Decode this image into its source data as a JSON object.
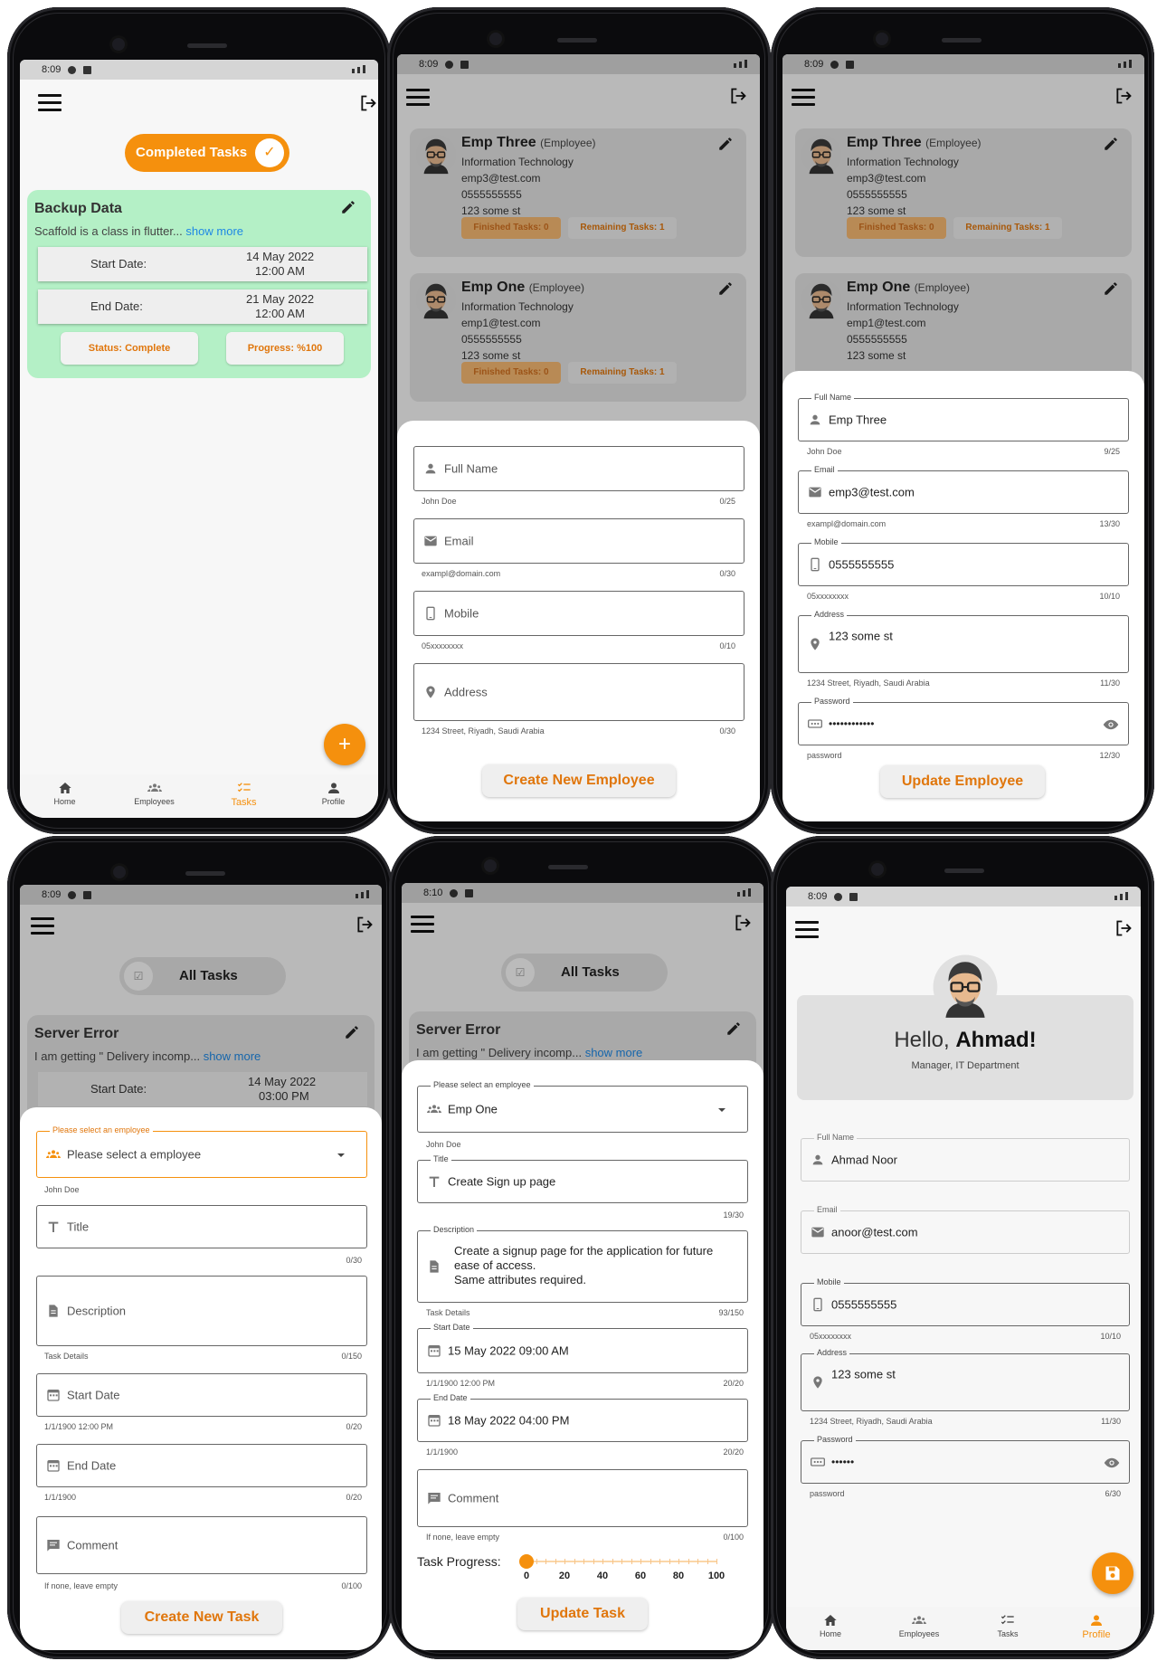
{
  "status_bar": {
    "time1": "8:09",
    "time2": "8:10"
  },
  "tasks_screen": {
    "toggle": "Completed Tasks",
    "card": {
      "title": "Backup Data",
      "desc": "Scaffold is a class in flutter...",
      "show_more": "show more",
      "start_label": "Start Date:",
      "start_date": "14 May 2022",
      "start_time": "12:00 AM",
      "end_label": "End Date:",
      "end_date": "21 May 2022",
      "end_time": "12:00 AM",
      "status": "Status: Complete",
      "progress": "Progress: %100"
    }
  },
  "nav": {
    "home": "Home",
    "employees": "Employees",
    "tasks": "Tasks",
    "profile": "Profile"
  },
  "employees": [
    {
      "name": "Emp Three",
      "role": "(Employee)",
      "dept": "Information Technology",
      "email": "emp3@test.com",
      "phone": "0555555555",
      "addr": "123 some st",
      "finished": "Finished Tasks: 0",
      "remaining": "Remaining Tasks: 1"
    },
    {
      "name": "Emp One",
      "role": "(Employee)",
      "dept": "Information Technology",
      "email": "emp1@test.com",
      "phone": "0555555555",
      "addr": "123 some st",
      "finished": "Finished Tasks: 0",
      "remaining": "Remaining Tasks: 1"
    }
  ],
  "create_employee": {
    "full_name": "Full Name",
    "full_name_helper": "John Doe",
    "full_name_count": "0/25",
    "email": "Email",
    "email_helper": "exampl@domain.com",
    "email_count": "0/30",
    "mobile": "Mobile",
    "mobile_helper": "05xxxxxxxx",
    "mobile_count": "0/10",
    "address": "Address",
    "address_helper": "1234 Street, Riyadh, Saudi Arabia",
    "address_count": "0/30",
    "button": "Create New Employee"
  },
  "update_employee": {
    "full_name_label": "Full Name",
    "full_name": "Emp Three",
    "full_name_helper": "John Doe",
    "full_name_count": "9/25",
    "email_label": "Email",
    "email": "emp3@test.com",
    "email_helper": "exampl@domain.com",
    "email_count": "13/30",
    "mobile_label": "Mobile",
    "mobile": "0555555555",
    "mobile_helper": "05xxxxxxxx",
    "mobile_count": "10/10",
    "address_label": "Address",
    "address": "123 some st",
    "address_helper": "1234 Street, Riyadh, Saudi Arabia",
    "address_count": "11/30",
    "password_label": "Password",
    "password": "••••••••••••",
    "password_helper": "password",
    "password_count": "12/30",
    "button": "Update Employee"
  },
  "all_tasks": {
    "toggle": "All Tasks",
    "card_title": "Server Error",
    "card_desc": "I am getting \" Delivery incomp...",
    "show_more": "show more",
    "start_label": "Start Date:",
    "start_date": "14 May 2022",
    "start_time": "03:00 PM"
  },
  "create_task": {
    "employee_label": "Please select an employee",
    "employee_ph": "Please select a employee",
    "employee_helper": "John Doe",
    "title": "Title",
    "title_count": "0/30",
    "description": "Description",
    "description_helper": "Task Details",
    "description_count": "0/150",
    "start": "Start Date",
    "start_helper": "1/1/1900 12:00 PM",
    "start_count": "0/20",
    "end": "End Date",
    "end_helper": "1/1/1900",
    "end_count": "0/20",
    "comment": "Comment",
    "comment_helper": "If none, leave empty",
    "comment_count": "0/100",
    "button": "Create New Task"
  },
  "update_task": {
    "employee_label": "Please select an employee",
    "employee": "Emp One",
    "employee_helper": "John Doe",
    "title_label": "Title",
    "title": "Create Sign up page",
    "title_count": "19/30",
    "description_label": "Description",
    "description_l1": "Create a signup page for the application for future",
    "description_l2": "ease of access.",
    "description_l3": "Same attributes required.",
    "description_helper": "Task Details",
    "description_count": "93/150",
    "start_label": "Start Date",
    "start": "15 May 2022 09:00 AM",
    "start_helper": "1/1/1900 12:00 PM",
    "start_count": "20/20",
    "end_label": "End Date",
    "end": "18 May 2022 04:00 PM",
    "end_helper": "1/1/1900",
    "end_count": "20/20",
    "comment": "Comment",
    "comment_helper": "If none, leave empty",
    "comment_count": "0/100",
    "progress_label": "Task Progress:",
    "progress_value": 0,
    "ticks": [
      "0",
      "20",
      "40",
      "60",
      "80",
      "100"
    ],
    "button": "Update Task"
  },
  "profile": {
    "hello": "Hello,",
    "name": "Ahmad!",
    "subtitle": "Manager, IT Department",
    "full_name_label": "Full Name",
    "full_name": "Ahmad Noor",
    "email_label": "Email",
    "email": "anoor@test.com",
    "mobile_label": "Mobile",
    "mobile": "0555555555",
    "mobile_helper": "05xxxxxxxx",
    "mobile_count": "10/10",
    "address_label": "Address",
    "address": "123 some st",
    "address_helper": "1234 Street, Riyadh, Saudi Arabia",
    "address_count": "11/30",
    "password_label": "Password",
    "password": "••••••",
    "password_helper": "password",
    "password_count": "6/30"
  },
  "colors": {
    "accent": "#f5900d",
    "accent_text": "#e0760c",
    "card_green": "#b4f0c6",
    "link": "#1e88e5"
  }
}
